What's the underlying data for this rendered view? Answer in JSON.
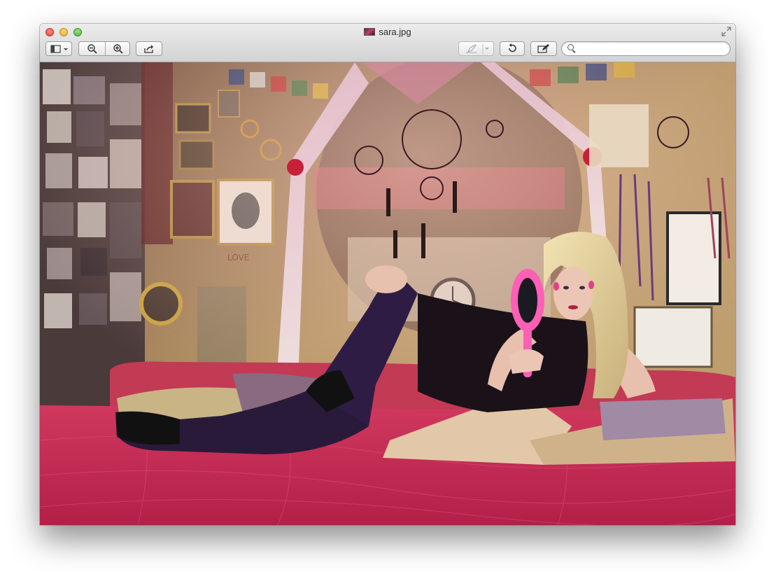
{
  "window": {
    "title": "sara.jpg"
  },
  "toolbar": {
    "sidebar_icon": "sidebar-icon",
    "zoom_out_icon": "zoom-out-icon",
    "zoom_in_icon": "zoom-in-icon",
    "share_icon": "share-icon",
    "markup_icon": "pen-icon",
    "rotate_icon": "rotate-icon",
    "edit_icon": "edit-icon",
    "search_placeholder": "",
    "search_value": ""
  },
  "colors": {
    "bedspread": "#c8284f",
    "wall": "#b89a6a",
    "canopy": "#e8c6d4",
    "hair": "#e8d6a0"
  }
}
